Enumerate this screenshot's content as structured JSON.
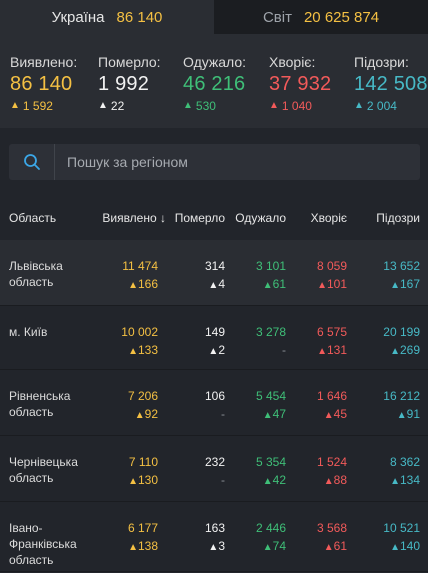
{
  "tabs": [
    {
      "name": "Україна",
      "count": "86 140",
      "active": true
    },
    {
      "name": "Світ",
      "count": "20 625 874",
      "active": false
    }
  ],
  "stats": [
    {
      "label": "Виявлено:",
      "value": "86 140",
      "delta": "1 592",
      "color": "yellow"
    },
    {
      "label": "Померло:",
      "value": "1 992",
      "delta": "22",
      "color": "white"
    },
    {
      "label": "Одужало:",
      "value": "46 216",
      "delta": "530",
      "color": "green"
    },
    {
      "label": "Хворіє:",
      "value": "37 932",
      "delta": "1 040",
      "color": "red"
    },
    {
      "label": "Підозри:",
      "value": "142 508",
      "delta": "2 004",
      "color": "cyan"
    }
  ],
  "search": {
    "placeholder": "Пошук за регіоном",
    "icon": "search-icon"
  },
  "table": {
    "headers": [
      "Область",
      "Виявлено",
      "Померло",
      "Одужало",
      "Хворіє",
      "Підозри"
    ],
    "sort_indicator": "↓",
    "rows": [
      {
        "region": [
          "Львівська",
          "область"
        ],
        "confirmed": "11 474",
        "confirmed_delta": "166",
        "deaths": "314",
        "deaths_delta": "4",
        "recovered": "3 101",
        "recovered_delta": "61",
        "sick": "8 059",
        "sick_delta": "101",
        "suspected": "13 652",
        "suspected_delta": "167"
      },
      {
        "region": [
          "м. Київ"
        ],
        "confirmed": "10 002",
        "confirmed_delta": "133",
        "deaths": "149",
        "deaths_delta": "2",
        "recovered": "3 278",
        "recovered_delta": "-",
        "sick": "6 575",
        "sick_delta": "131",
        "suspected": "20 199",
        "suspected_delta": "269"
      },
      {
        "region": [
          "Рівненська",
          "область"
        ],
        "confirmed": "7 206",
        "confirmed_delta": "92",
        "deaths": "106",
        "deaths_delta": "-",
        "recovered": "5 454",
        "recovered_delta": "47",
        "sick": "1 646",
        "sick_delta": "45",
        "suspected": "16 212",
        "suspected_delta": "91"
      },
      {
        "region": [
          "Чернівецька",
          "область"
        ],
        "confirmed": "7 110",
        "confirmed_delta": "130",
        "deaths": "232",
        "deaths_delta": "-",
        "recovered": "5 354",
        "recovered_delta": "42",
        "sick": "1 524",
        "sick_delta": "88",
        "suspected": "8 362",
        "suspected_delta": "134"
      },
      {
        "region": [
          "Івано-",
          "Франківська",
          "область"
        ],
        "confirmed": "6 177",
        "confirmed_delta": "138",
        "deaths": "163",
        "deaths_delta": "3",
        "recovered": "2 446",
        "recovered_delta": "74",
        "sick": "3 568",
        "sick_delta": "61",
        "suspected": "10 521",
        "suspected_delta": "140"
      }
    ]
  },
  "colors": {
    "background": "#22252b",
    "panel": "#2a2d33",
    "confirmed": "#f4c043",
    "deaths": "#f2f2f2",
    "recovered": "#3fbf78",
    "sick": "#f25a5a",
    "suspected": "#47b9c6"
  }
}
